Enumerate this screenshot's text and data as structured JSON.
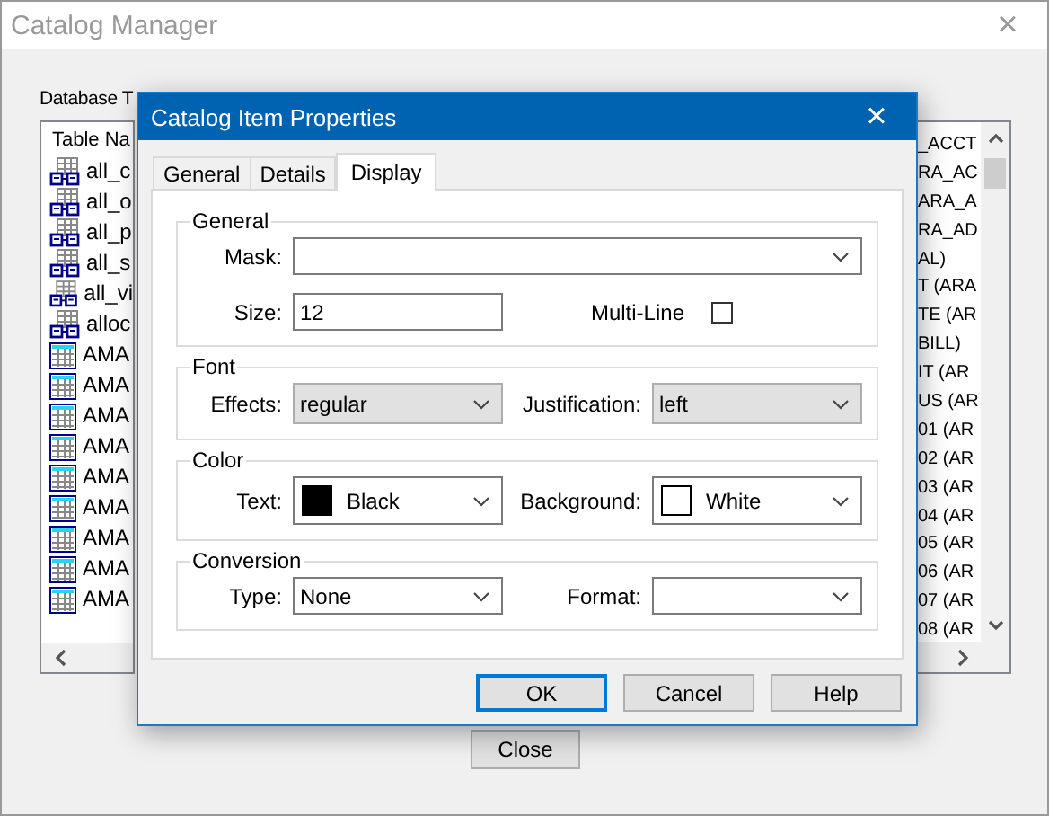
{
  "window": {
    "title": "Catalog Manager",
    "close": "×"
  },
  "database_tables": {
    "label": "Database T",
    "header": "Table Na",
    "items": [
      {
        "kind": "view",
        "text": "all_c"
      },
      {
        "kind": "view",
        "text": "all_o"
      },
      {
        "kind": "view",
        "text": "all_p"
      },
      {
        "kind": "view",
        "text": "all_s"
      },
      {
        "kind": "view",
        "text": "all_vi"
      },
      {
        "kind": "view",
        "text": "alloc"
      },
      {
        "kind": "table",
        "text": "AMA"
      },
      {
        "kind": "table",
        "text": "AMA"
      },
      {
        "kind": "table",
        "text": "AMA"
      },
      {
        "kind": "table",
        "text": "AMA"
      },
      {
        "kind": "table",
        "text": "AMA"
      },
      {
        "kind": "table",
        "text": "AMA"
      },
      {
        "kind": "table",
        "text": "AMA"
      },
      {
        "kind": "table",
        "text": "AMA"
      },
      {
        "kind": "table",
        "text": "AMA"
      }
    ]
  },
  "catalog_tables": {
    "items": [
      "_ACCT",
      "RA_AC",
      "ARA_A",
      "RA_AD",
      "AL)",
      "T (ARA",
      "TE (AR",
      "BILL)",
      "IT (AR",
      "US (AR",
      "01 (AR",
      "02 (AR",
      "03 (AR",
      "04 (AR",
      "05 (AR",
      "06 (AR",
      "07 (AR",
      "08 (AR"
    ]
  },
  "close_button": "Close",
  "dialog": {
    "title": "Catalog Item Properties",
    "close": "×",
    "tabs": [
      {
        "label": "General",
        "selected": false
      },
      {
        "label": "Details",
        "selected": false
      },
      {
        "label": "Display",
        "selected": true
      }
    ],
    "groups": [
      {
        "title": "General",
        "rows": [
          [
            {
              "kind": "combo",
              "label": "Mask:"
            }
          ],
          [
            {
              "kind": "text",
              "label": "Size:",
              "value": "12"
            },
            {
              "kind": "checkbox",
              "label": "Multi-Line",
              "checked": false
            }
          ]
        ]
      },
      {
        "title": "Font",
        "rows": [
          [
            {
              "kind": "dropdown",
              "label": "Effects:",
              "value": "regular"
            },
            {
              "kind": "dropdown",
              "label": "Justification:",
              "value": "left"
            }
          ]
        ]
      },
      {
        "title": "Color",
        "rows": [
          [
            {
              "kind": "color",
              "label": "Text:",
              "value": "Black",
              "color": "#000000"
            },
            {
              "kind": "color",
              "label": "Background:",
              "value": "White",
              "color": "#ffffff"
            }
          ]
        ]
      },
      {
        "title": "Conversion",
        "rows": [
          [
            {
              "kind": "combo",
              "label": "Type:",
              "value": "None"
            },
            {
              "kind": "combo",
              "label": "Format:"
            }
          ]
        ]
      }
    ],
    "buttons": [
      {
        "label": "OK",
        "default": true
      },
      {
        "label": "Cancel",
        "default": false
      },
      {
        "label": "Help",
        "default": false
      }
    ]
  }
}
